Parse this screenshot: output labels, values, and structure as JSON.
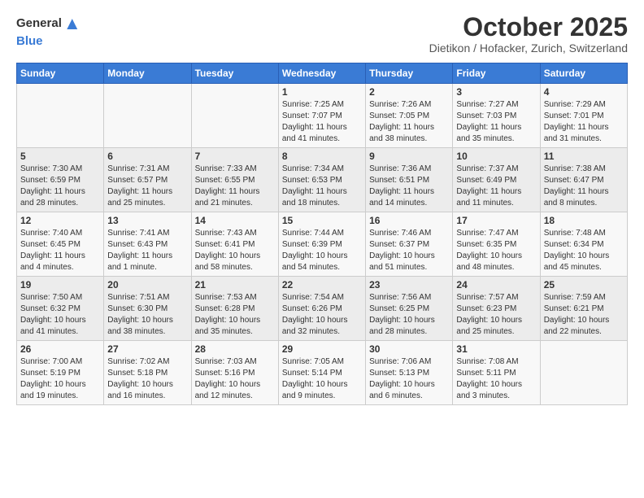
{
  "logo": {
    "general": "General",
    "blue": "Blue"
  },
  "title": "October 2025",
  "subtitle": "Dietikon / Hofacker, Zurich, Switzerland",
  "headers": [
    "Sunday",
    "Monday",
    "Tuesday",
    "Wednesday",
    "Thursday",
    "Friday",
    "Saturday"
  ],
  "weeks": [
    [
      {
        "day": "",
        "info": ""
      },
      {
        "day": "",
        "info": ""
      },
      {
        "day": "",
        "info": ""
      },
      {
        "day": "1",
        "info": "Sunrise: 7:25 AM\nSunset: 7:07 PM\nDaylight: 11 hours\nand 41 minutes."
      },
      {
        "day": "2",
        "info": "Sunrise: 7:26 AM\nSunset: 7:05 PM\nDaylight: 11 hours\nand 38 minutes."
      },
      {
        "day": "3",
        "info": "Sunrise: 7:27 AM\nSunset: 7:03 PM\nDaylight: 11 hours\nand 35 minutes."
      },
      {
        "day": "4",
        "info": "Sunrise: 7:29 AM\nSunset: 7:01 PM\nDaylight: 11 hours\nand 31 minutes."
      }
    ],
    [
      {
        "day": "5",
        "info": "Sunrise: 7:30 AM\nSunset: 6:59 PM\nDaylight: 11 hours\nand 28 minutes."
      },
      {
        "day": "6",
        "info": "Sunrise: 7:31 AM\nSunset: 6:57 PM\nDaylight: 11 hours\nand 25 minutes."
      },
      {
        "day": "7",
        "info": "Sunrise: 7:33 AM\nSunset: 6:55 PM\nDaylight: 11 hours\nand 21 minutes."
      },
      {
        "day": "8",
        "info": "Sunrise: 7:34 AM\nSunset: 6:53 PM\nDaylight: 11 hours\nand 18 minutes."
      },
      {
        "day": "9",
        "info": "Sunrise: 7:36 AM\nSunset: 6:51 PM\nDaylight: 11 hours\nand 14 minutes."
      },
      {
        "day": "10",
        "info": "Sunrise: 7:37 AM\nSunset: 6:49 PM\nDaylight: 11 hours\nand 11 minutes."
      },
      {
        "day": "11",
        "info": "Sunrise: 7:38 AM\nSunset: 6:47 PM\nDaylight: 11 hours\nand 8 minutes."
      }
    ],
    [
      {
        "day": "12",
        "info": "Sunrise: 7:40 AM\nSunset: 6:45 PM\nDaylight: 11 hours\nand 4 minutes."
      },
      {
        "day": "13",
        "info": "Sunrise: 7:41 AM\nSunset: 6:43 PM\nDaylight: 11 hours\nand 1 minute."
      },
      {
        "day": "14",
        "info": "Sunrise: 7:43 AM\nSunset: 6:41 PM\nDaylight: 10 hours\nand 58 minutes."
      },
      {
        "day": "15",
        "info": "Sunrise: 7:44 AM\nSunset: 6:39 PM\nDaylight: 10 hours\nand 54 minutes."
      },
      {
        "day": "16",
        "info": "Sunrise: 7:46 AM\nSunset: 6:37 PM\nDaylight: 10 hours\nand 51 minutes."
      },
      {
        "day": "17",
        "info": "Sunrise: 7:47 AM\nSunset: 6:35 PM\nDaylight: 10 hours\nand 48 minutes."
      },
      {
        "day": "18",
        "info": "Sunrise: 7:48 AM\nSunset: 6:34 PM\nDaylight: 10 hours\nand 45 minutes."
      }
    ],
    [
      {
        "day": "19",
        "info": "Sunrise: 7:50 AM\nSunset: 6:32 PM\nDaylight: 10 hours\nand 41 minutes."
      },
      {
        "day": "20",
        "info": "Sunrise: 7:51 AM\nSunset: 6:30 PM\nDaylight: 10 hours\nand 38 minutes."
      },
      {
        "day": "21",
        "info": "Sunrise: 7:53 AM\nSunset: 6:28 PM\nDaylight: 10 hours\nand 35 minutes."
      },
      {
        "day": "22",
        "info": "Sunrise: 7:54 AM\nSunset: 6:26 PM\nDaylight: 10 hours\nand 32 minutes."
      },
      {
        "day": "23",
        "info": "Sunrise: 7:56 AM\nSunset: 6:25 PM\nDaylight: 10 hours\nand 28 minutes."
      },
      {
        "day": "24",
        "info": "Sunrise: 7:57 AM\nSunset: 6:23 PM\nDaylight: 10 hours\nand 25 minutes."
      },
      {
        "day": "25",
        "info": "Sunrise: 7:59 AM\nSunset: 6:21 PM\nDaylight: 10 hours\nand 22 minutes."
      }
    ],
    [
      {
        "day": "26",
        "info": "Sunrise: 7:00 AM\nSunset: 5:19 PM\nDaylight: 10 hours\nand 19 minutes."
      },
      {
        "day": "27",
        "info": "Sunrise: 7:02 AM\nSunset: 5:18 PM\nDaylight: 10 hours\nand 16 minutes."
      },
      {
        "day": "28",
        "info": "Sunrise: 7:03 AM\nSunset: 5:16 PM\nDaylight: 10 hours\nand 12 minutes."
      },
      {
        "day": "29",
        "info": "Sunrise: 7:05 AM\nSunset: 5:14 PM\nDaylight: 10 hours\nand 9 minutes."
      },
      {
        "day": "30",
        "info": "Sunrise: 7:06 AM\nSunset: 5:13 PM\nDaylight: 10 hours\nand 6 minutes."
      },
      {
        "day": "31",
        "info": "Sunrise: 7:08 AM\nSunset: 5:11 PM\nDaylight: 10 hours\nand 3 minutes."
      },
      {
        "day": "",
        "info": ""
      }
    ]
  ]
}
